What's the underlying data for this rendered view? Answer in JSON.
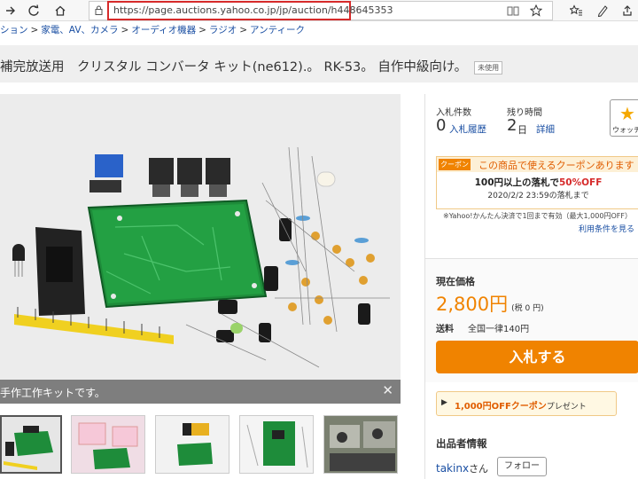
{
  "browser": {
    "url": "https://page.auctions.yahoo.co.jp/jp/auction/h448645353"
  },
  "breadcrumb": [
    "ション",
    "家電、AV、カメラ",
    "オーディオ機器",
    "ラジオ",
    "アンティーク"
  ],
  "title": {
    "text": "補完放送用　クリスタル コンバータ キット(ne612).。 RK-53。 自作中級向け。",
    "badge": "未使用"
  },
  "image": {
    "caption": "手作工作キットです。"
  },
  "bids": {
    "label": "入札件数",
    "count": "0",
    "history_link": "入札履歴"
  },
  "time_left": {
    "label": "残り時間",
    "value": "2",
    "unit": "日",
    "detail_link": "詳細"
  },
  "watch": {
    "label": "ウォッチ"
  },
  "coupon": {
    "tag": "クーポン",
    "heading": "この商品で使えるクーポンあります",
    "line_prefix": "100円以上の落札で",
    "line_highlight": "50%OFF",
    "deadline": "2020/2/2 23:59の落札まで",
    "note": "※Yahoo!かんたん決済で1回まで有効（最大1,000円OFF）",
    "terms_link": "利用条件を見る"
  },
  "price": {
    "label": "現在価格",
    "value": "2,800円",
    "tax": "(税 0 円)",
    "shipping_label": "送料",
    "shipping_value": "全国一律140円",
    "bid_button": "入札する"
  },
  "coupon_present": {
    "highlight": "1,000円OFFクーポン",
    "suffix": "プレゼント"
  },
  "seller": {
    "heading": "出品者情報",
    "name": "takinx",
    "honorific": "さん",
    "follow_button": "フォロー"
  },
  "colors": {
    "accent_orange": "#f08300",
    "link_blue": "#1a4fa3",
    "url_highlight_red": "#d62a2a",
    "pcb_green": "#1e8c3a"
  }
}
